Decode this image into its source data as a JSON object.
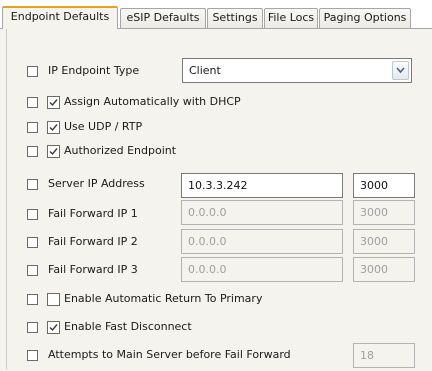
{
  "tabs": [
    "Endpoint Defaults",
    "eSIP Defaults",
    "Settings",
    "File Locs",
    "Paging Options"
  ],
  "endpoint_type": {
    "label": "IP Endpoint Type",
    "value": "Client"
  },
  "assign_dhcp": {
    "label": "Assign Automatically with DHCP",
    "checked": true
  },
  "use_udp": {
    "label": "Use UDP / RTP",
    "checked": true
  },
  "authorized": {
    "label": "Authorized Endpoint",
    "checked": true
  },
  "server_ip": {
    "label": "Server IP Address",
    "ip": "10.3.3.242",
    "port": "3000"
  },
  "fail_forward": [
    {
      "label": "Fail Forward IP 1",
      "ip": "0.0.0.0",
      "port": "3000"
    },
    {
      "label": "Fail Forward IP 2",
      "ip": "0.0.0.0",
      "port": "3000"
    },
    {
      "label": "Fail Forward IP 3",
      "ip": "0.0.0.0",
      "port": "3000"
    }
  ],
  "auto_return": {
    "label": "Enable Automatic Return To Primary",
    "checked": false
  },
  "fast_disconnect": {
    "label": "Enable Fast Disconnect",
    "checked": true
  },
  "attempts": {
    "label": "Attempts to Main Server before Fail Forward",
    "value": "18"
  }
}
